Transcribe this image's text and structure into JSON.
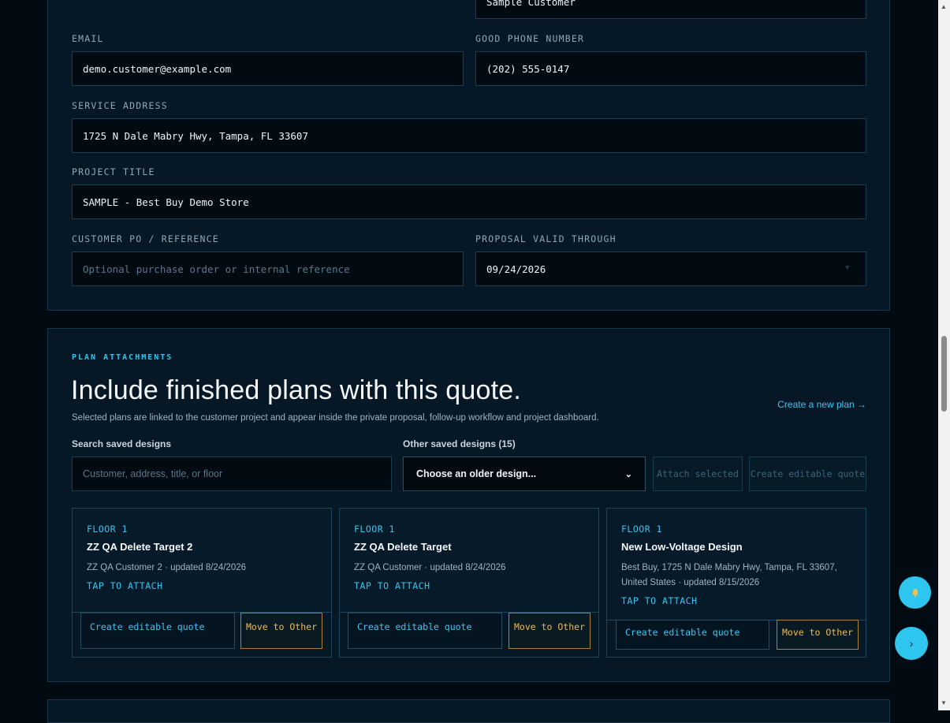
{
  "customer_form": {
    "name_value": "Sample Customer",
    "email_label": "EMAIL",
    "email_value": "demo.customer@example.com",
    "phone_label": "GOOD PHONE NUMBER",
    "phone_value": "(202) 555-0147",
    "address_label": "SERVICE ADDRESS",
    "address_value": "1725 N Dale Mabry Hwy, Tampa, FL 33607",
    "title_label": "PROJECT TITLE",
    "title_value": "SAMPLE - Best Buy Demo Store",
    "po_label": "CUSTOMER PO / REFERENCE",
    "po_placeholder": "Optional purchase order or internal reference",
    "valid_label": "PROPOSAL VALID THROUGH",
    "valid_value": "09/24/2026"
  },
  "plans": {
    "kicker": "PLAN ATTACHMENTS",
    "headline": "Include finished plans with this quote.",
    "subtitle": "Selected plans are linked to the customer project and appear inside the private proposal, follow-up workflow and project dashboard.",
    "create_plan_link": "Create a new plan →",
    "search_label": "Search saved designs",
    "search_placeholder": "Customer, address, title, or floor",
    "other_label": "Other saved designs (15)",
    "select_value": "Choose an older design...",
    "attach_button": "Attach selected",
    "editable_button": "Create editable quote",
    "cards": [
      {
        "floor": "FLOOR 1",
        "title": "ZZ QA Delete Target 2",
        "meta": "ZZ QA Customer 2 · updated 8/24/2026",
        "attach": "TAP TO ATTACH",
        "quote_button": "Create editable quote",
        "move_button": "Move to Other"
      },
      {
        "floor": "FLOOR 1",
        "title": "ZZ QA Delete Target",
        "meta": "ZZ QA Customer · updated 8/24/2026",
        "attach": "TAP TO ATTACH",
        "quote_button": "Create editable quote",
        "move_button": "Move to Other"
      },
      {
        "floor": "FLOOR 1",
        "title": "New Low-Voltage Design",
        "meta": "Best Buy, 1725 N Dale Mabry Hwy, Tampa, FL 33607, United States · updated 8/15/2026",
        "attach": "TAP TO ATTACH",
        "quote_button": "Create editable quote",
        "move_button": "Move to Other"
      }
    ]
  },
  "fabs": {
    "bell_icon": "bell-icon",
    "next_icon": "chevron-right-icon",
    "next_glyph": "›"
  },
  "colors": {
    "accent": "#2ec5ef",
    "background": "#030b12",
    "panel": "#061826",
    "warning": "#e9b95c"
  }
}
